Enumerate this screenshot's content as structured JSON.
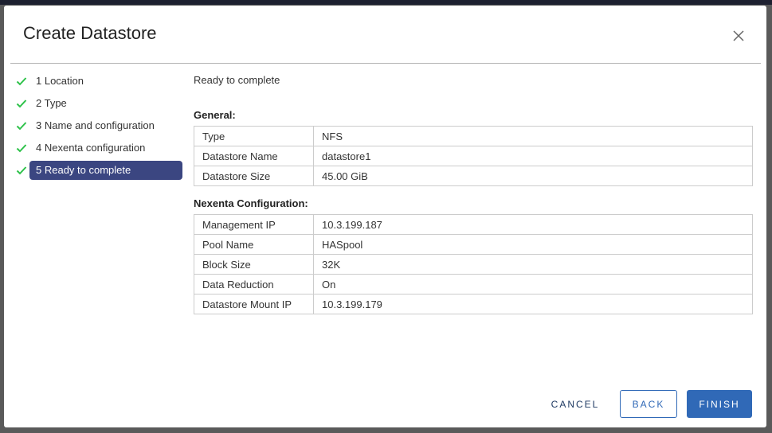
{
  "dialog": {
    "title": "Create Datastore",
    "close_icon": "close-icon"
  },
  "steps": [
    {
      "label": "1  Location",
      "done": true
    },
    {
      "label": "2  Type",
      "done": true
    },
    {
      "label": "3  Name and configuration",
      "done": true
    },
    {
      "label": "4  Nexenta configuration",
      "done": true
    },
    {
      "label": "5  Ready to complete",
      "done": true,
      "active": true
    }
  ],
  "main": {
    "heading": "Ready to complete",
    "general": {
      "title": "General:",
      "rows": [
        [
          "Type",
          "NFS"
        ],
        [
          "Datastore Name",
          "datastore1"
        ],
        [
          "Datastore Size",
          "45.00 GiB"
        ]
      ]
    },
    "nexenta": {
      "title": "Nexenta Configuration:",
      "rows": [
        [
          "Management IP",
          "10.3.199.187"
        ],
        [
          "Pool Name",
          "HASpool"
        ],
        [
          "Block Size",
          "32K"
        ],
        [
          "Data Reduction",
          "On"
        ],
        [
          "Datastore Mount IP",
          "10.3.199.179"
        ]
      ]
    }
  },
  "footer": {
    "cancel": "CANCEL",
    "back": "BACK",
    "finish": "FINISH"
  },
  "colors": {
    "accent": "#3069b7",
    "active_step": "#3b4681",
    "check": "#2ec24a"
  }
}
